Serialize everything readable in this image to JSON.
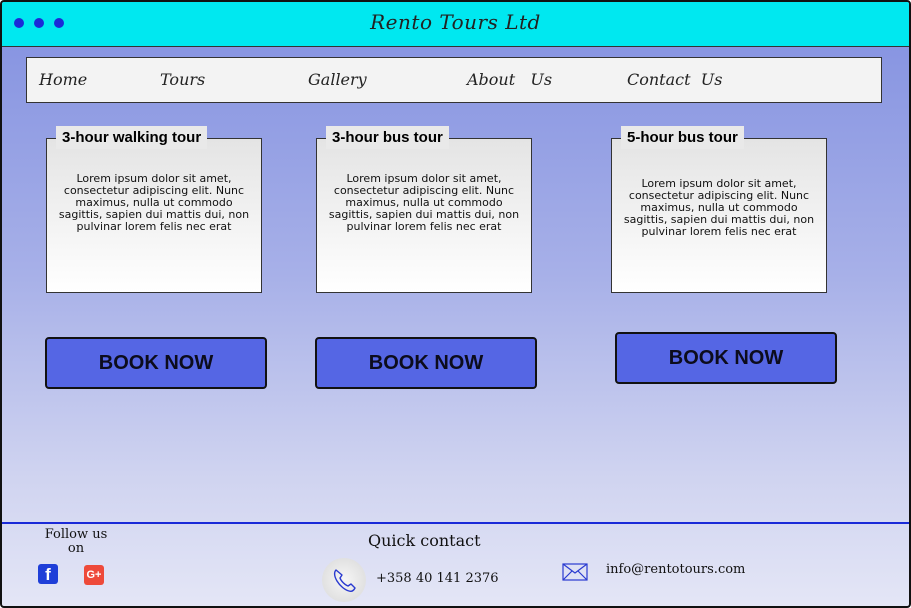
{
  "brand": "Rento Tours Ltd",
  "colors": {
    "titlebar": "#00e8f0",
    "accent": "#1a2ad8",
    "button": "#5566e4"
  },
  "nav": {
    "items": [
      {
        "label": "Home"
      },
      {
        "label": "Tours"
      },
      {
        "label": "Gallery"
      },
      {
        "label": "About   Us"
      },
      {
        "label": "Contact  Us"
      }
    ]
  },
  "tours": [
    {
      "title": "3-hour walking tour",
      "description": "Lorem ipsum dolor sit amet, consectetur adipiscing elit. Nunc maximus, nulla ut commodo sagittis, sapien dui mattis dui, non pulvinar lorem felis nec erat",
      "button": "BOOK NOW"
    },
    {
      "title": "3-hour bus tour",
      "description": "Lorem ipsum dolor sit amet, consectetur adipiscing elit. Nunc maximus, nulla ut commodo sagittis, sapien dui mattis dui, non pulvinar lorem felis nec erat",
      "button": "BOOK NOW"
    },
    {
      "title": "5-hour bus tour",
      "description": "Lorem ipsum dolor sit amet, consectetur adipiscing elit. Nunc maximus, nulla ut commodo sagittis, sapien dui mattis dui, non pulvinar lorem felis nec erat",
      "button": "BOOK NOW"
    }
  ],
  "footer": {
    "follow_label": "Follow us on",
    "social": [
      {
        "icon": "facebook-icon",
        "glyph": "f"
      },
      {
        "icon": "google-plus-icon",
        "glyph": "G+"
      }
    ],
    "quick_contact_label": "Quick contact",
    "phone": "+358 40 141 2376",
    "email": "info@rentotours.com"
  }
}
